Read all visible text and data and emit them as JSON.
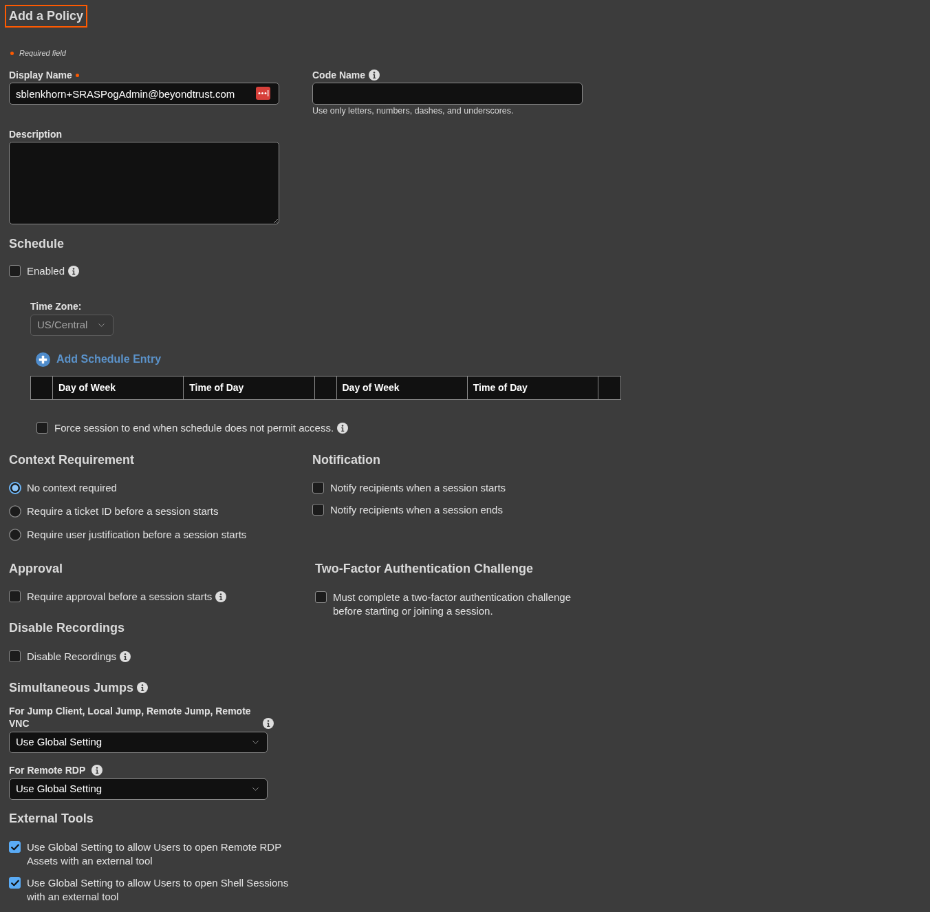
{
  "page_title": "Add a Policy",
  "required_note": "Required field",
  "display_name": {
    "label": "Display Name",
    "required": true,
    "value": "sblenkhorn+SRASPogAdmin@beyondtrust.com"
  },
  "code_name": {
    "label": "Code Name",
    "hint": "Use only letters, numbers, dashes, and underscores."
  },
  "description": {
    "label": "Description"
  },
  "schedule": {
    "heading": "Schedule",
    "enabled": {
      "label": "Enabled",
      "checked": false
    },
    "time_zone": {
      "label": "Time Zone:",
      "value": "US/Central",
      "disabled": true
    },
    "add_entry_button": "Add Schedule Entry",
    "table": {
      "columns": [
        {
          "kind": "blank"
        },
        {
          "kind": "text",
          "label": "Day of Week"
        },
        {
          "kind": "text",
          "label": "Time of Day"
        },
        {
          "kind": "blank"
        },
        {
          "kind": "text",
          "label": "Day of Week"
        },
        {
          "kind": "text",
          "label": "Time of Day"
        },
        {
          "kind": "blank"
        }
      ]
    },
    "force_end": {
      "label": "Force session to end when schedule does not permit access.",
      "checked": false
    }
  },
  "context_requirement": {
    "heading": "Context Requirement",
    "options": [
      {
        "label": "No context required",
        "selected": true
      },
      {
        "label": "Require a ticket ID before a session starts",
        "selected": false
      },
      {
        "label": "Require user justification before a session starts",
        "selected": false
      }
    ]
  },
  "notification": {
    "heading": "Notification",
    "options": [
      {
        "label": "Notify recipients when a session starts",
        "checked": false
      },
      {
        "label": "Notify recipients when a session ends",
        "checked": false
      }
    ]
  },
  "approval": {
    "heading": "Approval",
    "option": {
      "label": "Require approval before a session starts",
      "checked": false
    }
  },
  "two_factor": {
    "heading": "Two-Factor Authentication Challenge",
    "option": {
      "label": "Must complete a two-factor authentication challenge before starting or joining a session.",
      "checked": false
    }
  },
  "disable_recordings": {
    "heading": "Disable Recordings",
    "option": {
      "label": "Disable Recordings",
      "checked": false
    }
  },
  "simultaneous_jumps": {
    "heading": "Simultaneous Jumps",
    "fields": [
      {
        "label": "For Jump Client, Local Jump, Remote Jump, Remote VNC",
        "value": "Use Global Setting"
      },
      {
        "label": "For Remote RDP",
        "value": "Use Global Setting"
      }
    ]
  },
  "external_tools": {
    "heading": "External Tools",
    "options": [
      {
        "label": "Use Global Setting to allow Users to open Remote RDP Assets with an external tool",
        "checked": true
      },
      {
        "label": "Use Global Setting to allow Users to open Shell Sessions with an external tool",
        "checked": true
      }
    ]
  }
}
